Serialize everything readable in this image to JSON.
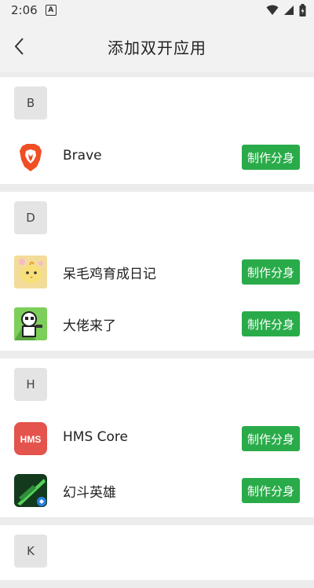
{
  "status": {
    "time": "2:06",
    "notif_glyph": "A"
  },
  "header": {
    "title": "添加双开应用"
  },
  "sections": [
    {
      "letter": "B",
      "apps": [
        {
          "name": "Brave",
          "action": "制作分身"
        }
      ]
    },
    {
      "letter": "D",
      "apps": [
        {
          "name": "呆毛鸡育成日记",
          "action": "制作分身"
        },
        {
          "name": "大佬来了",
          "action": "制作分身"
        }
      ]
    },
    {
      "letter": "H",
      "apps": [
        {
          "name": "HMS Core",
          "action": "制作分身",
          "icon_text": "HMS"
        },
        {
          "name": "幻斗英雄",
          "action": "制作分身"
        }
      ]
    },
    {
      "letter": "K",
      "apps": []
    }
  ],
  "colors": {
    "accent": "#2aab4a",
    "hms": "#e4534c",
    "brave": "#f04e23"
  }
}
